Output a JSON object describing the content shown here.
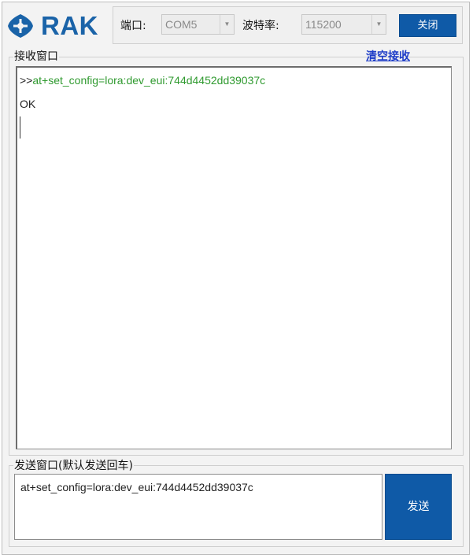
{
  "header": {
    "logo_text": "RAK",
    "port_label": "端口:",
    "port_value": "COM5",
    "baud_label": "波特率:",
    "baud_value": "115200",
    "close_label": "关闭"
  },
  "receive": {
    "title": "接收窗口",
    "clear_label": "清空接收",
    "prompt": ">>",
    "command": "at+set_config=lora:dev_eui:744d4452dd39037c",
    "response": "OK"
  },
  "send": {
    "title": "发送窗口(默认发送回车)",
    "input_value": "at+set_config=lora:dev_eui:744d4452dd39037c",
    "send_label": "发送"
  },
  "colors": {
    "brand": "#1a63a8",
    "button": "#0f5aa7",
    "command_text": "#2f9a2f",
    "link": "#1f3ec8"
  },
  "icons": {
    "logo": "rak-logo-icon",
    "dropdown": "chevron-down-icon"
  }
}
